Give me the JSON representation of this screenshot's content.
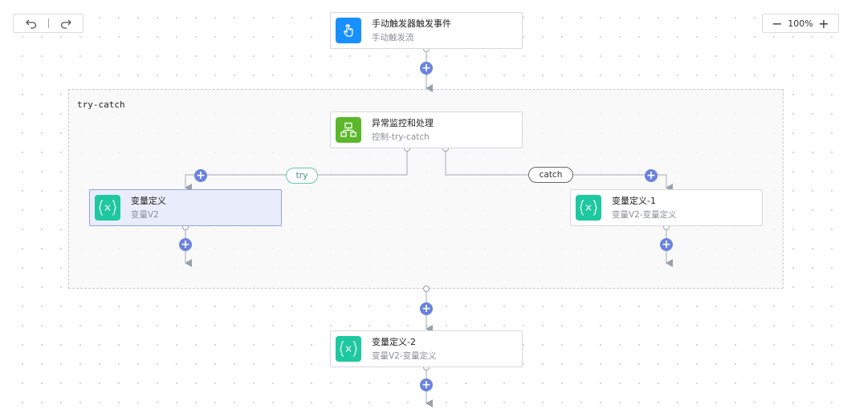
{
  "toolbar": {
    "undo_icon": "undo-icon",
    "redo_icon": "redo-icon",
    "zoom_out_symbol": "−",
    "zoom_level": "100%",
    "zoom_in_symbol": "+"
  },
  "group": {
    "label": "try-catch"
  },
  "nodes": {
    "trigger": {
      "title": "手动触发器触发事件",
      "subtitle": "手动触发流",
      "icon": "hand-pointer-icon",
      "color": "#1890ff"
    },
    "trycatch": {
      "title": "异常监控和处理",
      "subtitle": "控制-try-catch",
      "icon": "hierarchy-icon",
      "color": "#5cb82a"
    },
    "var_try": {
      "title": "变量定义",
      "subtitle": "变量V2",
      "icon": "variable-braces-icon",
      "color": "#1ec8a0"
    },
    "var_catch": {
      "title": "变量定义-1",
      "subtitle": "变量V2-变量定义",
      "icon": "variable-braces-icon",
      "color": "#1ec8a0"
    },
    "var_after": {
      "title": "变量定义-2",
      "subtitle": "变量V2-变量定义",
      "icon": "variable-braces-icon",
      "color": "#1ec8a0"
    }
  },
  "branches": {
    "try": "try",
    "catch": "catch"
  },
  "add_button_symbol": "+"
}
